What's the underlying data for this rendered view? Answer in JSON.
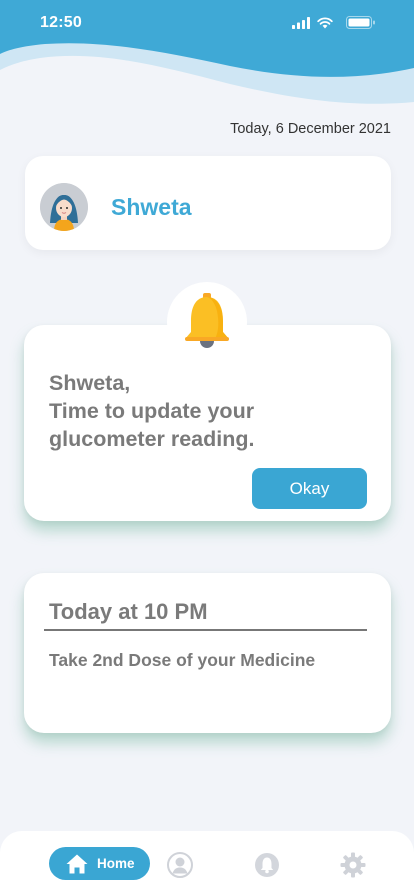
{
  "status_bar": {
    "time": "12:50",
    "signal_icon": "cellular-signal-icon",
    "wifi_icon": "wifi-icon",
    "battery_icon": "battery-icon"
  },
  "date": "Today, 6 December 2021",
  "profile": {
    "name": "Shweta",
    "avatar_icon": "user-avatar"
  },
  "alert": {
    "icon": "bell-icon",
    "lines": [
      "Shweta,",
      "Time to update your",
      "glucometer reading."
    ],
    "button_label": "Okay"
  },
  "reminder": {
    "time": "Today at 10 PM",
    "text": "Take 2nd Dose of your Medicine"
  },
  "nav": {
    "home_label": "Home",
    "items": [
      "home-icon",
      "profile-icon",
      "notification-icon",
      "settings-icon"
    ]
  },
  "colors": {
    "accent": "#3aa6d3",
    "name": "#3fa9d6",
    "background": "#f2f4f9",
    "text_muted": "#7a7a7a",
    "bell": "#fbbf24"
  }
}
